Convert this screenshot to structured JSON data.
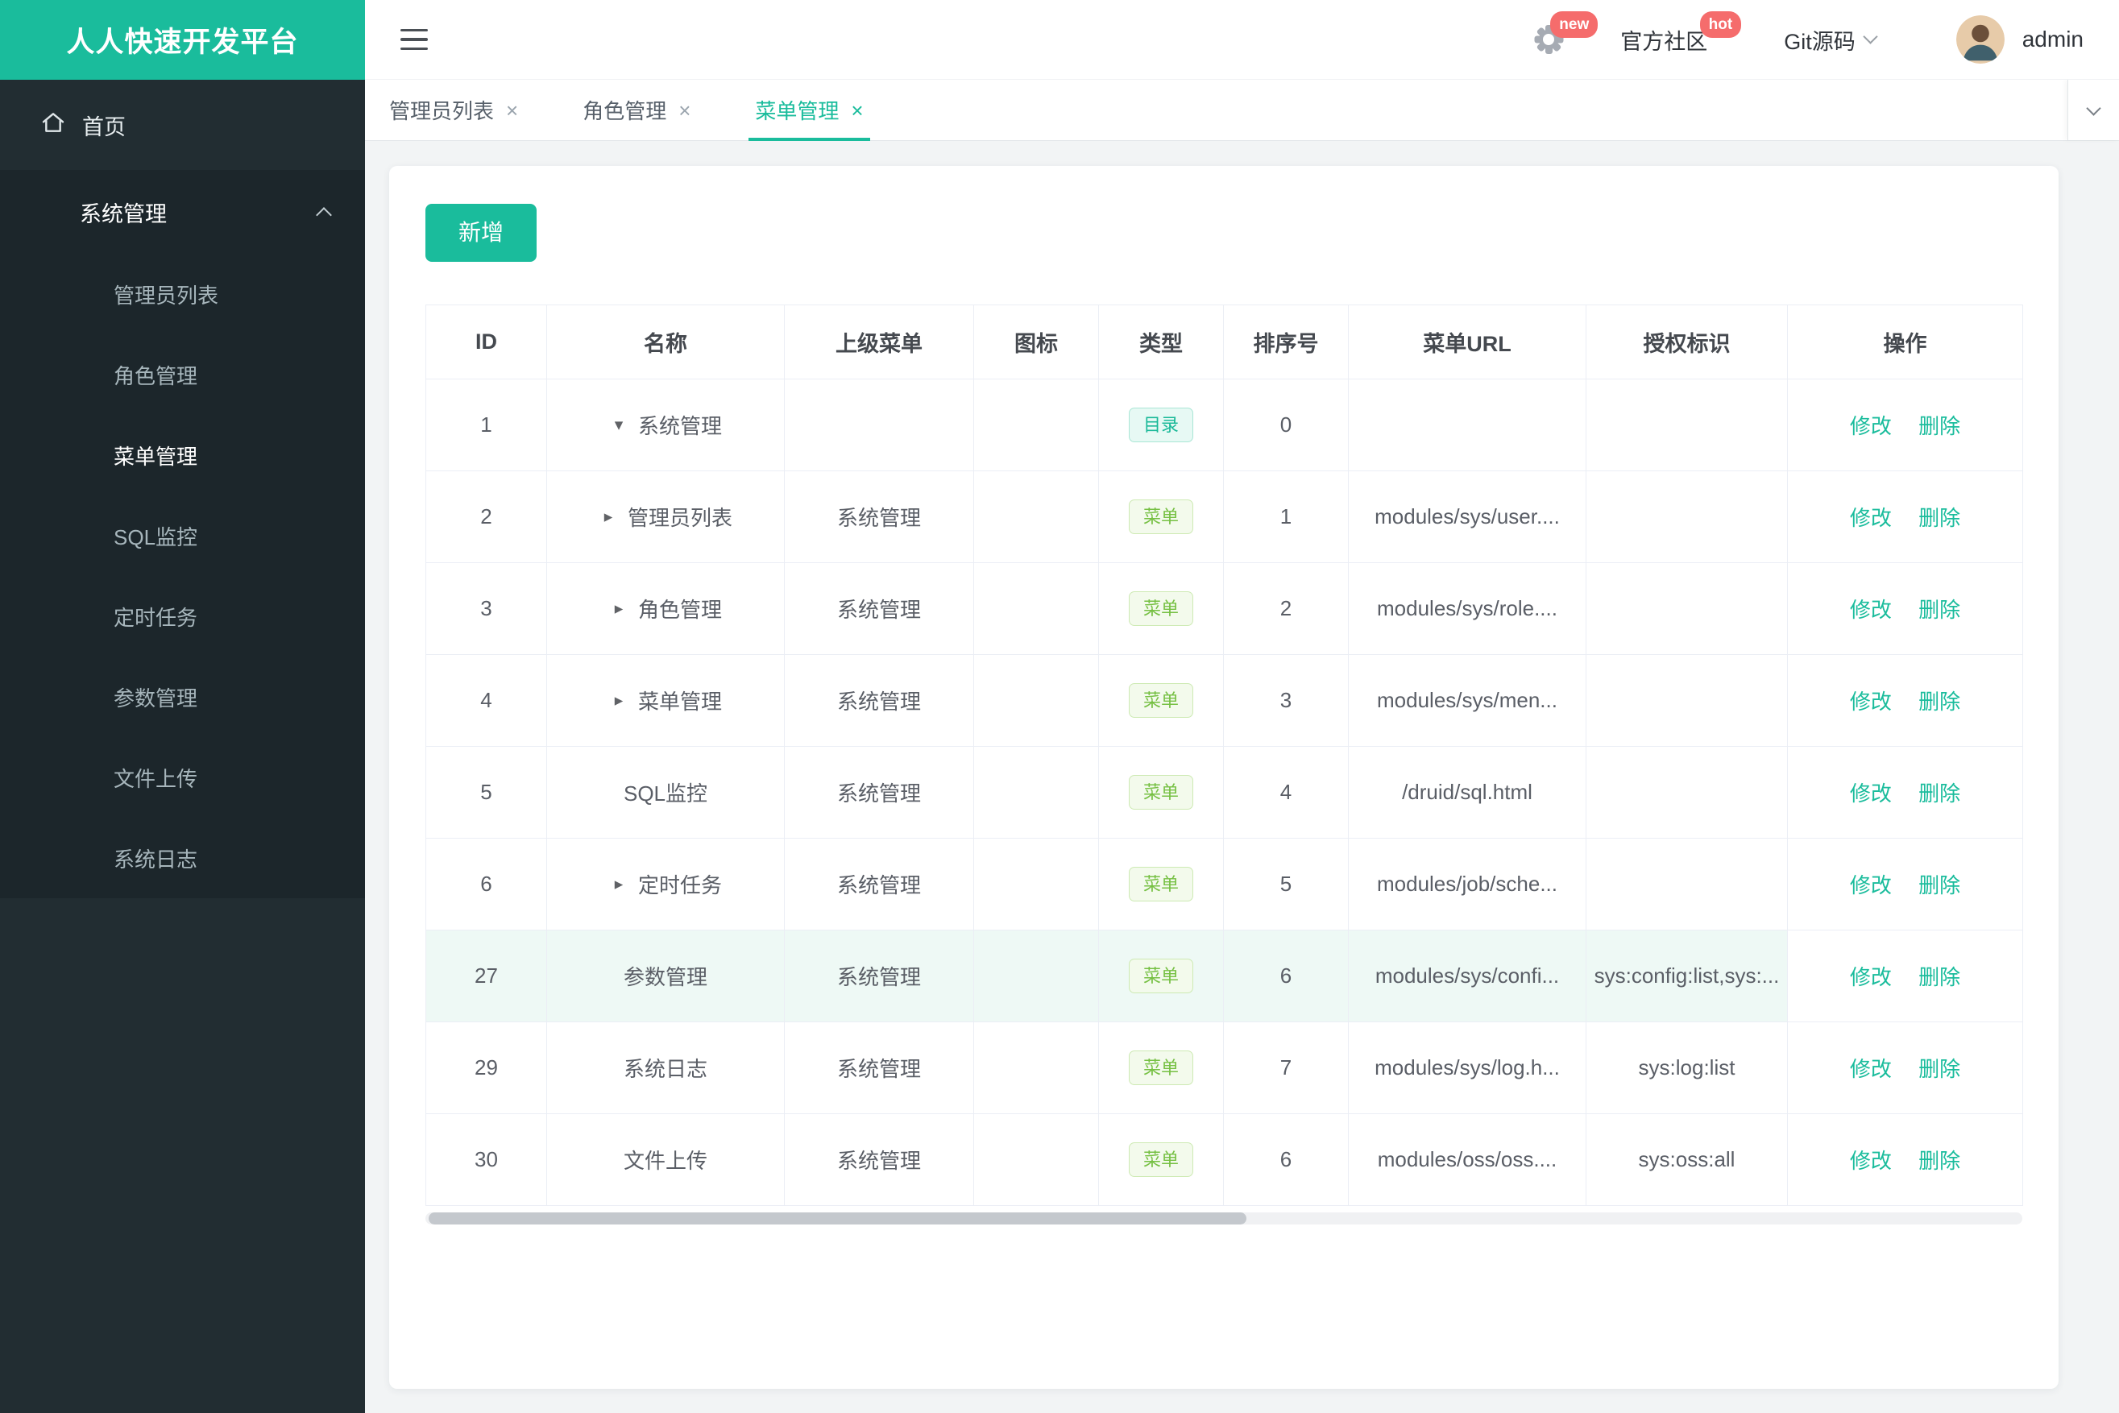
{
  "colors": {
    "accent": "#1abc9c",
    "badge_red": "#f56c6c",
    "sidebar_bg": "#222d32",
    "sidebar_tree_bg": "#1c262b",
    "tag_dir_color": "#19b998",
    "tag_menu_color": "#76c043",
    "row_highlight": "#eef9f5"
  },
  "brand": {
    "title": "人人快速开发平台"
  },
  "sidebar": {
    "home_label": "首页",
    "section": {
      "title": "系统管理",
      "items": [
        {
          "label": "管理员列表"
        },
        {
          "label": "角色管理"
        },
        {
          "label": "菜单管理",
          "active": true
        },
        {
          "label": "SQL监控"
        },
        {
          "label": "定时任务"
        },
        {
          "label": "参数管理"
        },
        {
          "label": "文件上传"
        },
        {
          "label": "系统日志"
        }
      ]
    }
  },
  "header": {
    "new_badge": "new",
    "community_label": "官方社区",
    "hot_badge": "hot",
    "git_label": "Git源码",
    "username": "admin"
  },
  "tabs": {
    "items": [
      {
        "label": "管理员列表"
      },
      {
        "label": "角色管理"
      },
      {
        "label": "菜单管理",
        "active": true
      }
    ]
  },
  "icons": {
    "close": "×"
  },
  "toolbar": {
    "add_label": "新增"
  },
  "table": {
    "columns": [
      "ID",
      "名称",
      "上级菜单",
      "图标",
      "类型",
      "排序号",
      "菜单URL",
      "授权标识",
      "操作"
    ],
    "actions": {
      "edit": "修改",
      "delete": "删除"
    },
    "rows": [
      {
        "id": "1",
        "arrow": "▾",
        "name": "系统管理",
        "parent": "",
        "type": "目录",
        "order": "0",
        "url": "",
        "perms": ""
      },
      {
        "id": "2",
        "arrow": "▸",
        "name": "管理员列表",
        "parent": "系统管理",
        "type": "菜单",
        "order": "1",
        "url": "modules/sys/user....",
        "perms": ""
      },
      {
        "id": "3",
        "arrow": "▸",
        "name": "角色管理",
        "parent": "系统管理",
        "type": "菜单",
        "order": "2",
        "url": "modules/sys/role....",
        "perms": ""
      },
      {
        "id": "4",
        "arrow": "▸",
        "name": "菜单管理",
        "parent": "系统管理",
        "type": "菜单",
        "order": "3",
        "url": "modules/sys/men...",
        "perms": ""
      },
      {
        "id": "5",
        "arrow": "",
        "name": "SQL监控",
        "parent": "系统管理",
        "type": "菜单",
        "order": "4",
        "url": "/druid/sql.html",
        "perms": ""
      },
      {
        "id": "6",
        "arrow": "▸",
        "name": "定时任务",
        "parent": "系统管理",
        "type": "菜单",
        "order": "5",
        "url": "modules/job/sche...",
        "perms": ""
      },
      {
        "id": "27",
        "arrow": "",
        "name": "参数管理",
        "parent": "系统管理",
        "type": "菜单",
        "order": "6",
        "url": "modules/sys/confi...",
        "perms": "sys:config:list,sys:...",
        "highlight": true
      },
      {
        "id": "29",
        "arrow": "",
        "name": "系统日志",
        "parent": "系统管理",
        "type": "菜单",
        "order": "7",
        "url": "modules/sys/log.h...",
        "perms": "sys:log:list"
      },
      {
        "id": "30",
        "arrow": "",
        "name": "文件上传",
        "parent": "系统管理",
        "type": "菜单",
        "order": "6",
        "url": "modules/oss/oss....",
        "perms": "sys:oss:all"
      }
    ]
  }
}
